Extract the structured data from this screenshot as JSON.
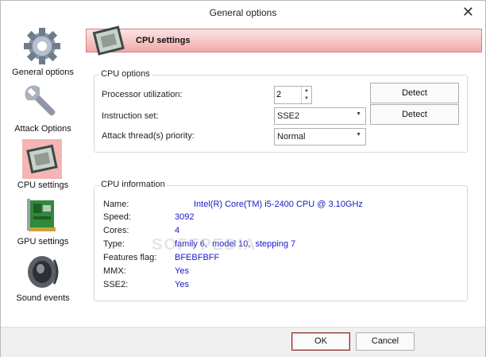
{
  "window": {
    "title": "General options",
    "close_glyph": "✕"
  },
  "nav": {
    "items": [
      {
        "label": "General options",
        "icon": "gear-icon"
      },
      {
        "label": "Attack Options",
        "icon": "wrench-icon"
      },
      {
        "label": "CPU settings",
        "icon": "cpu-chip-icon",
        "selected": true
      },
      {
        "label": "GPU settings",
        "icon": "graphics-card-icon"
      },
      {
        "label": "Sound events",
        "icon": "speaker-icon"
      }
    ]
  },
  "header": {
    "title": "CPU settings",
    "icon": "cpu-chip-icon",
    "accent": "#f2a9a9"
  },
  "cpu_options": {
    "legend": "CPU options",
    "processor_utilization": {
      "label": "Processor utilization:",
      "value": "2"
    },
    "instruction_set": {
      "label": "Instruction set:",
      "value": "SSE2"
    },
    "thread_priority": {
      "label": "Attack thread(s) priority:",
      "value": "Normal"
    },
    "detect_label": "Detect"
  },
  "cpu_info": {
    "legend": "CPU information",
    "rows": [
      {
        "label": "Name:",
        "value": "Intel(R) Core(TM) i5-2400 CPU @ 3.10GHz"
      },
      {
        "label": "Speed:",
        "value": "3092"
      },
      {
        "label": "Cores:",
        "value": "4"
      },
      {
        "label": "Type:",
        "value": "family 6,  model 10,  stepping 7"
      },
      {
        "label": "Features flag:",
        "value": "BFEBFBFF"
      },
      {
        "label": "MMX:",
        "value": "Yes"
      },
      {
        "label": "SSE2:",
        "value": "Yes"
      }
    ],
    "value_color": "#1818c8"
  },
  "footer": {
    "ok_label": "OK",
    "cancel_label": "Cancel"
  },
  "watermark": "SOFTPEDIA"
}
